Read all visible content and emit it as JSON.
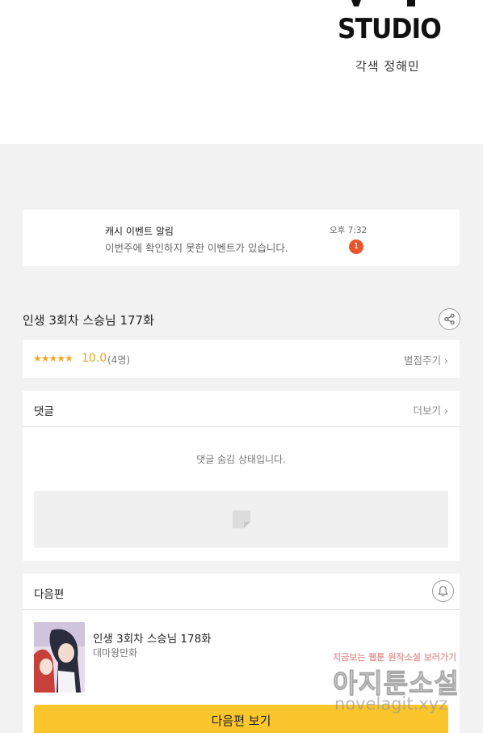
{
  "banner": {
    "studio": "STUDIO",
    "credit": "각색 정해민"
  },
  "notification": {
    "title": "캐시 이벤트 알림",
    "message": "이번주에 확인하지 못한 이벤트가 있습니다.",
    "time": "오후 7:32",
    "badge_count": "1",
    "badge_color": "#e8552c"
  },
  "episode": {
    "title": "인생 3회차 스승님 177화",
    "share_icon": "share-icon"
  },
  "rating": {
    "stars": "★★★★★",
    "score": "10.0",
    "count": "(4명)",
    "rate_link": "별점주기 ›",
    "star_color": "#f5a623"
  },
  "comments": {
    "label": "댓글",
    "more_link": "더보기 ›",
    "hidden_message": "댓글 숨김 상태입니다."
  },
  "next": {
    "label": "다음편",
    "bell_icon": "bell-icon",
    "episode_title": "인생 3회차 스승님 178화",
    "author": "대마왕만화",
    "button_label": "다음편 보기",
    "button_color": "#fbc52c"
  },
  "watermark": {
    "line1": "지금보는 웹툰 원작소설 보러가기",
    "line2": "아지툰소설",
    "line3": "novelagit.xyz"
  }
}
